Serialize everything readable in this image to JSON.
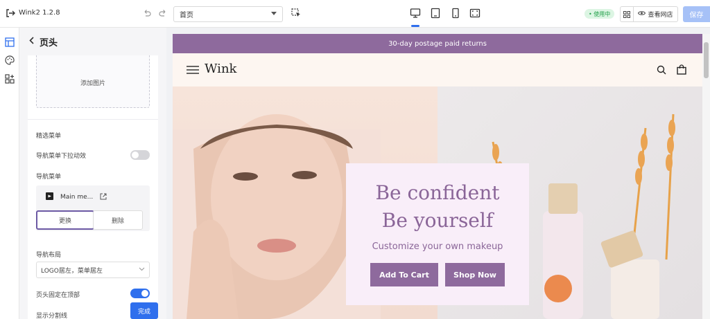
{
  "app": {
    "title": "Wink2 1.2.8"
  },
  "toolbar": {
    "page_select_value": "首页",
    "status_badge": "• 使用中",
    "view_store_label": "查看网店",
    "save_label": "保存"
  },
  "panel": {
    "title": "页头",
    "add_image_label": "添加图片",
    "featured_menu_label": "精选菜单",
    "dropdown_effect_label": "导航菜单下拉动效",
    "dropdown_effect_on": false,
    "nav_menu_label": "导航菜单",
    "nav_menu_name": "Main me...",
    "replace_label": "更换",
    "delete_label": "删除",
    "nav_layout_label": "导航布局",
    "nav_layout_value": "LOGO居左，菜单居左",
    "sticky_header_label": "页头固定在顶部",
    "sticky_header_on": true,
    "show_divider_label": "显示分割线",
    "show_divider_on": true,
    "done_label": "完成"
  },
  "preview": {
    "announcement": "30-day postage paid returns",
    "logo": "Wink",
    "hero": {
      "line1": "Be confident",
      "line2": "Be yourself",
      "subtitle": "Customize your own makeup",
      "cart_button": "Add To Cart",
      "shop_button": "Shop Now"
    }
  },
  "colors": {
    "accent": "#2f6fed",
    "brand_purple": "#8e6a9d",
    "status_green": "#22a04a"
  }
}
